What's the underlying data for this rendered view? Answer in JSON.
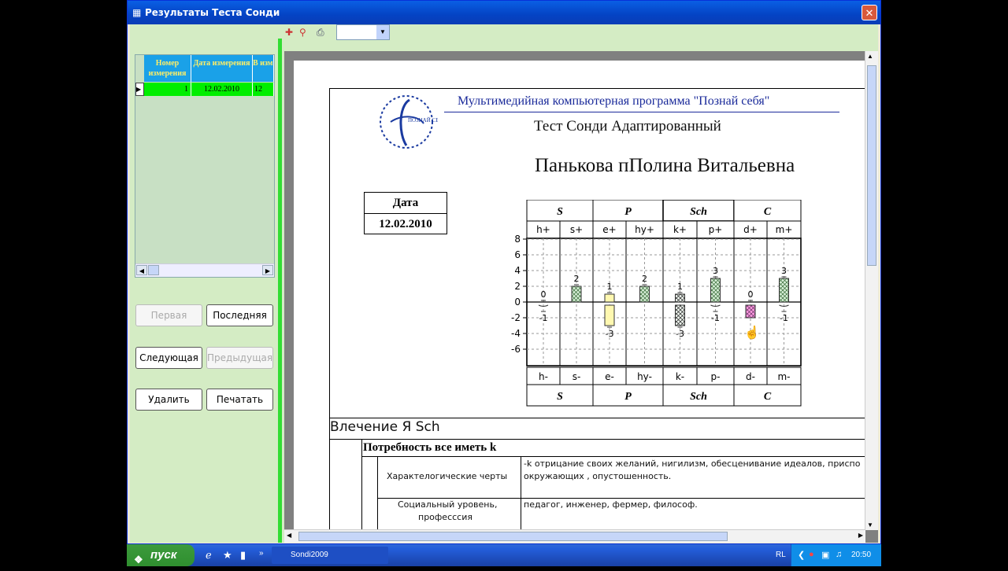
{
  "window": {
    "title": "Результаты Теста Сонди",
    "close": "✕"
  },
  "grid": {
    "headers": [
      "Номер измерения",
      "Дата измерения",
      "В измер"
    ],
    "row": {
      "num": "1",
      "date": "12.02.2010",
      "time": "12"
    }
  },
  "buttons": {
    "first": "Первая",
    "last": "Последняя",
    "next": "Следующая",
    "prev": "Предыдущая",
    "delete": "Удалить",
    "print": "Печатать"
  },
  "report": {
    "program": "Мультимедийная компьютерная программа \"Познай себя\"",
    "test": "Тест Сонди Адаптированный",
    "name": "Панькова пПолина Витальевна",
    "logo_text": "ПОЗНАЙ СЕБЯ",
    "date_label": "Дата",
    "date_value": "12.02.2010",
    "section": "Влечение Я Sch",
    "need": "Потребность все иметь k",
    "row1_label": "Характелогические черты",
    "row1_text_a": "-k отрицание своих желаний, нигилизм, обесценивание идеалов, приспо",
    "row1_text_b": "окружающих , опустошенность.",
    "row2_label_a": "Социальный уровень,",
    "row2_label_b": "професссия",
    "row2_text": "педагог, инженер, фермер, философ."
  },
  "chart_data": {
    "type": "bar",
    "groups": [
      "S",
      "P",
      "Sch",
      "C"
    ],
    "factors_top": [
      "h+",
      "s+",
      "e+",
      "hy+",
      "k+",
      "p+",
      "d+",
      "m+"
    ],
    "factors_bottom": [
      "h-",
      "s-",
      "e-",
      "hy-",
      "k-",
      "p-",
      "d-",
      "m-"
    ],
    "y_ticks": [
      "8",
      "6",
      "4",
      "2",
      "0",
      "-2",
      "-4",
      "-6"
    ],
    "ylim": [
      -6,
      8
    ],
    "positive": [
      0,
      2,
      1,
      2,
      1,
      3,
      0,
      3
    ],
    "negative": [
      -1,
      0,
      -3,
      0,
      -3,
      -1,
      -2,
      -1
    ],
    "positive_labels": [
      "0",
      "2",
      "1",
      "2",
      "1",
      "3",
      "0",
      "3"
    ],
    "negative_labels": [
      "-1",
      "",
      "-3",
      "",
      "-3",
      "-1",
      "",
      "-1"
    ],
    "colors": {
      "grid": "#999999",
      "hatch_green": "#7fbf7f",
      "yellow": "#fff8b0",
      "pink": "#ff9ae0"
    }
  },
  "taskbar": {
    "start": "пуск",
    "task": "Sondi2009",
    "lang": "RL",
    "clock": "20:50"
  }
}
